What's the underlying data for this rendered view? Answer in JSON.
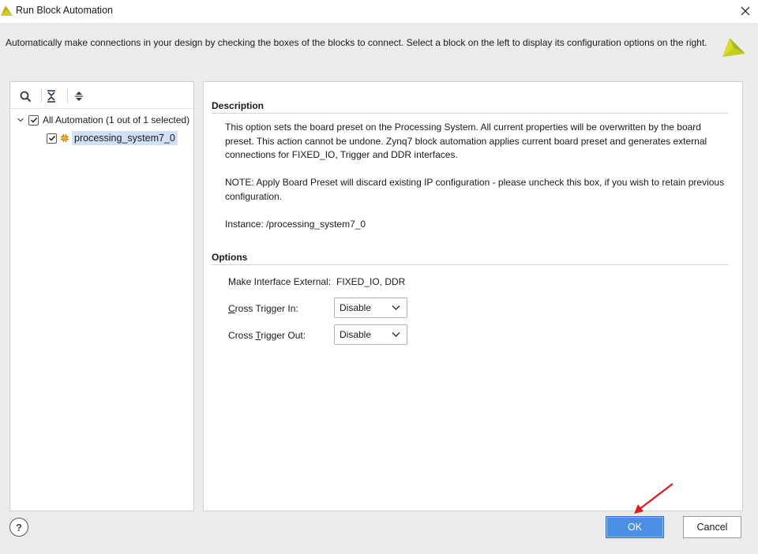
{
  "window": {
    "title": "Run Block Automation"
  },
  "header": {
    "description": "Automatically make connections in your design by checking the boxes of the blocks to connect. Select a block on the left to display its configuration options on the right."
  },
  "tree": {
    "root_label": "All Automation (1 out of 1 selected)",
    "root_checked": true,
    "child_label": "processing_system7_0",
    "child_checked": true
  },
  "config": {
    "description_title": "Description",
    "description_p1": "This option sets the board preset on the Processing System. All current properties will be overwritten by the board preset. This action cannot be undone. Zynq7 block automation applies current board preset and generates external connections for FIXED_IO, Trigger and DDR interfaces.",
    "description_p2": "NOTE: Apply Board Preset will discard existing IP configuration - please uncheck this box, if you wish to retain previous configuration.",
    "instance_text": "Instance: /processing_system7_0",
    "options_title": "Options",
    "make_external_label": "Make Interface External:",
    "make_external_value": "FIXED_IO, DDR",
    "cross_trigger_in": {
      "label_mnemonic": "C",
      "label_rest": "ross Trigger In:",
      "value": "Disable"
    },
    "cross_trigger_out": {
      "label_pre": "Cross ",
      "label_mnemonic": "T",
      "label_rest": "rigger Out:",
      "value": "Disable"
    }
  },
  "footer": {
    "help_label": "?",
    "ok_label": "OK",
    "cancel_label": "Cancel"
  },
  "colors": {
    "ok_button": "#4a8ee6",
    "selection": "#cfe0f7",
    "annotation_arrow": "#e01b1b",
    "brand": "#b8c41a"
  }
}
